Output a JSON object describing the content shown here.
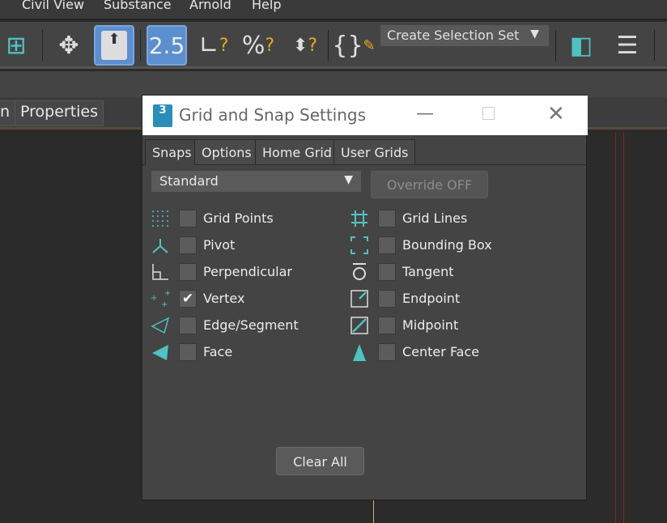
{
  "menu": [
    "Civil View",
    "Substance",
    "Arnold",
    "Help"
  ],
  "toolbar": {
    "selection_set": "Create Selection Set",
    "snap_label": "2.5"
  },
  "panel_tabs": {
    "partial": "n",
    "properties": "Properties"
  },
  "dialog": {
    "title": "Grid and Snap Settings",
    "app_logo": "3",
    "tabs": [
      "Snaps",
      "Options",
      "Home Grid",
      "User Grids"
    ],
    "active_tab": "Snaps",
    "dropdown": "Standard",
    "override": "Override OFF",
    "snaps_left": [
      {
        "label": "Grid Points",
        "checked": false,
        "icon": "grid-points-icon"
      },
      {
        "label": "Pivot",
        "checked": false,
        "icon": "pivot-icon"
      },
      {
        "label": "Perpendicular",
        "checked": false,
        "icon": "perpendicular-icon"
      },
      {
        "label": "Vertex",
        "checked": true,
        "icon": "vertex-icon"
      },
      {
        "label": "Edge/Segment",
        "checked": false,
        "icon": "edge-icon"
      },
      {
        "label": "Face",
        "checked": false,
        "icon": "face-icon"
      }
    ],
    "snaps_right": [
      {
        "label": "Grid Lines",
        "checked": false,
        "icon": "grid-lines-icon"
      },
      {
        "label": "Bounding Box",
        "checked": false,
        "icon": "bounding-box-icon"
      },
      {
        "label": "Tangent",
        "checked": false,
        "icon": "tangent-icon"
      },
      {
        "label": "Endpoint",
        "checked": false,
        "icon": "endpoint-icon"
      },
      {
        "label": "Midpoint",
        "checked": false,
        "icon": "midpoint-icon"
      },
      {
        "label": "Center Face",
        "checked": false,
        "icon": "center-face-icon"
      }
    ],
    "clear_all": "Clear All"
  },
  "colors": {
    "accent": "#4fc3c3",
    "active": "#5b8fd0"
  }
}
